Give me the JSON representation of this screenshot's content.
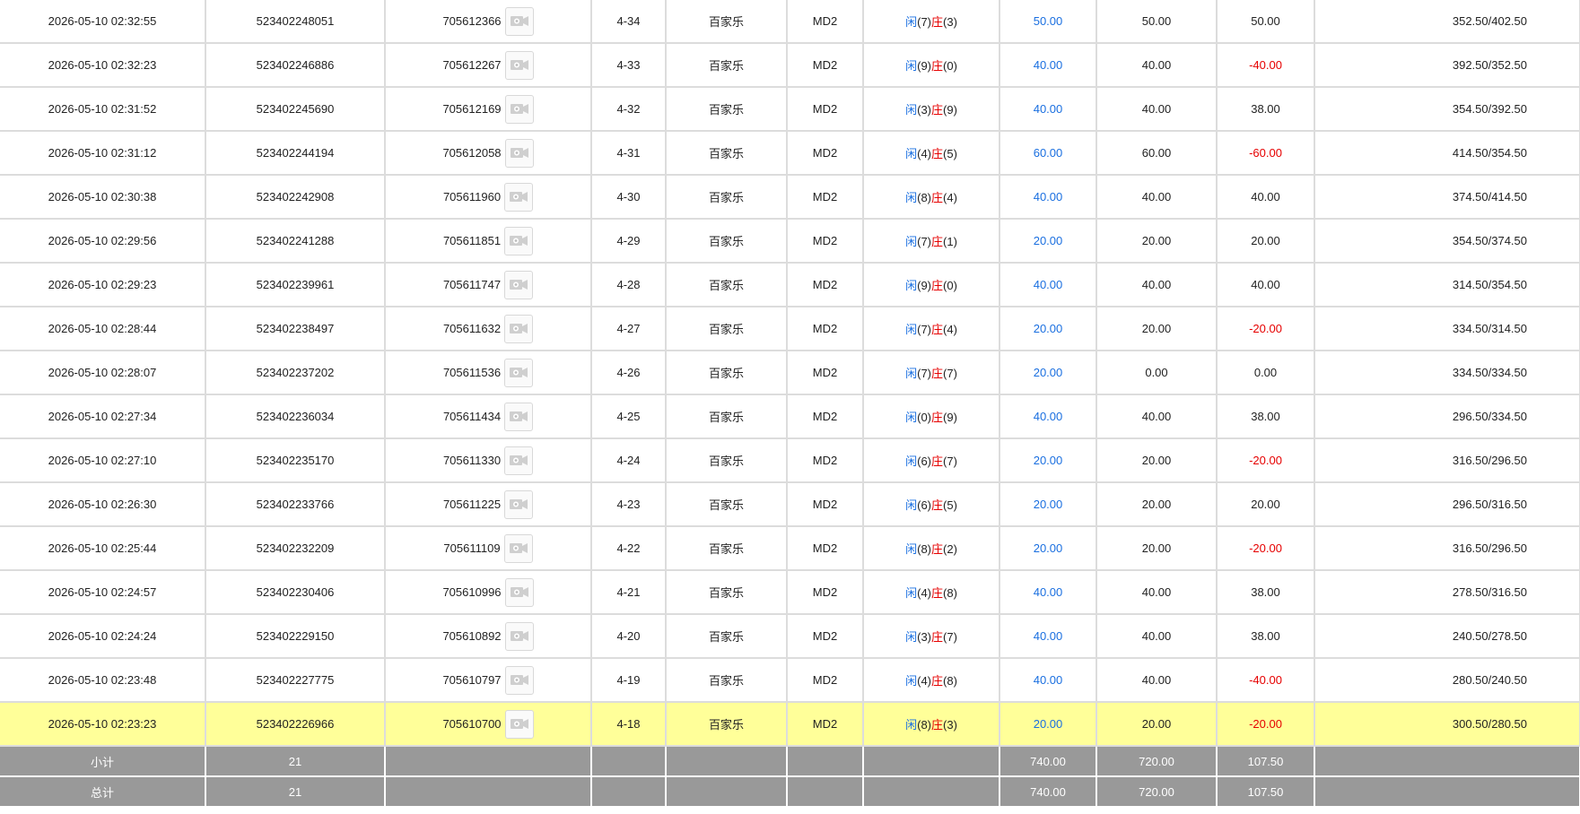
{
  "rows": [
    {
      "time": "2026-05-10 02:32:55",
      "bet_id": "523402248051",
      "game_id": "705612366",
      "shoe": "4-34",
      "game": "百家乐",
      "table": "MD2",
      "idle_label": "闲",
      "idle": "(7)",
      "banker_label": "庄",
      "banker": "(3)",
      "bet": "50.00",
      "valid": "50.00",
      "winloss": "50.00",
      "winloss_neg": false,
      "balance": "352.50/402.50"
    },
    {
      "time": "2026-05-10 02:32:23",
      "bet_id": "523402246886",
      "game_id": "705612267",
      "shoe": "4-33",
      "game": "百家乐",
      "table": "MD2",
      "idle_label": "闲",
      "idle": "(9)",
      "banker_label": "庄",
      "banker": "(0)",
      "bet": "40.00",
      "valid": "40.00",
      "winloss": "-40.00",
      "winloss_neg": true,
      "balance": "392.50/352.50"
    },
    {
      "time": "2026-05-10 02:31:52",
      "bet_id": "523402245690",
      "game_id": "705612169",
      "shoe": "4-32",
      "game": "百家乐",
      "table": "MD2",
      "idle_label": "闲",
      "idle": "(3)",
      "banker_label": "庄",
      "banker": "(9)",
      "bet": "40.00",
      "valid": "40.00",
      "winloss": "38.00",
      "winloss_neg": false,
      "balance": "354.50/392.50"
    },
    {
      "time": "2026-05-10 02:31:12",
      "bet_id": "523402244194",
      "game_id": "705612058",
      "shoe": "4-31",
      "game": "百家乐",
      "table": "MD2",
      "idle_label": "闲",
      "idle": "(4)",
      "banker_label": "庄",
      "banker": "(5)",
      "bet": "60.00",
      "valid": "60.00",
      "winloss": "-60.00",
      "winloss_neg": true,
      "balance": "414.50/354.50"
    },
    {
      "time": "2026-05-10 02:30:38",
      "bet_id": "523402242908",
      "game_id": "705611960",
      "shoe": "4-30",
      "game": "百家乐",
      "table": "MD2",
      "idle_label": "闲",
      "idle": "(8)",
      "banker_label": "庄",
      "banker": "(4)",
      "bet": "40.00",
      "valid": "40.00",
      "winloss": "40.00",
      "winloss_neg": false,
      "balance": "374.50/414.50"
    },
    {
      "time": "2026-05-10 02:29:56",
      "bet_id": "523402241288",
      "game_id": "705611851",
      "shoe": "4-29",
      "game": "百家乐",
      "table": "MD2",
      "idle_label": "闲",
      "idle": "(7)",
      "banker_label": "庄",
      "banker": "(1)",
      "bet": "20.00",
      "valid": "20.00",
      "winloss": "20.00",
      "winloss_neg": false,
      "balance": "354.50/374.50"
    },
    {
      "time": "2026-05-10 02:29:23",
      "bet_id": "523402239961",
      "game_id": "705611747",
      "shoe": "4-28",
      "game": "百家乐",
      "table": "MD2",
      "idle_label": "闲",
      "idle": "(9)",
      "banker_label": "庄",
      "banker": "(0)",
      "bet": "40.00",
      "valid": "40.00",
      "winloss": "40.00",
      "winloss_neg": false,
      "balance": "314.50/354.50"
    },
    {
      "time": "2026-05-10 02:28:44",
      "bet_id": "523402238497",
      "game_id": "705611632",
      "shoe": "4-27",
      "game": "百家乐",
      "table": "MD2",
      "idle_label": "闲",
      "idle": "(7)",
      "banker_label": "庄",
      "banker": "(4)",
      "bet": "20.00",
      "valid": "20.00",
      "winloss": "-20.00",
      "winloss_neg": true,
      "balance": "334.50/314.50"
    },
    {
      "time": "2026-05-10 02:28:07",
      "bet_id": "523402237202",
      "game_id": "705611536",
      "shoe": "4-26",
      "game": "百家乐",
      "table": "MD2",
      "idle_label": "闲",
      "idle": "(7)",
      "banker_label": "庄",
      "banker": "(7)",
      "bet": "20.00",
      "valid": "0.00",
      "winloss": "0.00",
      "winloss_neg": false,
      "balance": "334.50/334.50"
    },
    {
      "time": "2026-05-10 02:27:34",
      "bet_id": "523402236034",
      "game_id": "705611434",
      "shoe": "4-25",
      "game": "百家乐",
      "table": "MD2",
      "idle_label": "闲",
      "idle": "(0)",
      "banker_label": "庄",
      "banker": "(9)",
      "bet": "40.00",
      "valid": "40.00",
      "winloss": "38.00",
      "winloss_neg": false,
      "balance": "296.50/334.50"
    },
    {
      "time": "2026-05-10 02:27:10",
      "bet_id": "523402235170",
      "game_id": "705611330",
      "shoe": "4-24",
      "game": "百家乐",
      "table": "MD2",
      "idle_label": "闲",
      "idle": "(6)",
      "banker_label": "庄",
      "banker": "(7)",
      "bet": "20.00",
      "valid": "20.00",
      "winloss": "-20.00",
      "winloss_neg": true,
      "balance": "316.50/296.50"
    },
    {
      "time": "2026-05-10 02:26:30",
      "bet_id": "523402233766",
      "game_id": "705611225",
      "shoe": "4-23",
      "game": "百家乐",
      "table": "MD2",
      "idle_label": "闲",
      "idle": "(6)",
      "banker_label": "庄",
      "banker": "(5)",
      "bet": "20.00",
      "valid": "20.00",
      "winloss": "20.00",
      "winloss_neg": false,
      "balance": "296.50/316.50"
    },
    {
      "time": "2026-05-10 02:25:44",
      "bet_id": "523402232209",
      "game_id": "705611109",
      "shoe": "4-22",
      "game": "百家乐",
      "table": "MD2",
      "idle_label": "闲",
      "idle": "(8)",
      "banker_label": "庄",
      "banker": "(2)",
      "bet": "20.00",
      "valid": "20.00",
      "winloss": "-20.00",
      "winloss_neg": true,
      "balance": "316.50/296.50"
    },
    {
      "time": "2026-05-10 02:24:57",
      "bet_id": "523402230406",
      "game_id": "705610996",
      "shoe": "4-21",
      "game": "百家乐",
      "table": "MD2",
      "idle_label": "闲",
      "idle": "(4)",
      "banker_label": "庄",
      "banker": "(8)",
      "bet": "40.00",
      "valid": "40.00",
      "winloss": "38.00",
      "winloss_neg": false,
      "balance": "278.50/316.50"
    },
    {
      "time": "2026-05-10 02:24:24",
      "bet_id": "523402229150",
      "game_id": "705610892",
      "shoe": "4-20",
      "game": "百家乐",
      "table": "MD2",
      "idle_label": "闲",
      "idle": "(3)",
      "banker_label": "庄",
      "banker": "(7)",
      "bet": "40.00",
      "valid": "40.00",
      "winloss": "38.00",
      "winloss_neg": false,
      "balance": "240.50/278.50"
    },
    {
      "time": "2026-05-10 02:23:48",
      "bet_id": "523402227775",
      "game_id": "705610797",
      "shoe": "4-19",
      "game": "百家乐",
      "table": "MD2",
      "idle_label": "闲",
      "idle": "(4)",
      "banker_label": "庄",
      "banker": "(8)",
      "bet": "40.00",
      "valid": "40.00",
      "winloss": "-40.00",
      "winloss_neg": true,
      "balance": "280.50/240.50"
    },
    {
      "time": "2026-05-10 02:23:23",
      "bet_id": "523402226966",
      "game_id": "705610700",
      "shoe": "4-18",
      "game": "百家乐",
      "table": "MD2",
      "idle_label": "闲",
      "idle": "(8)",
      "banker_label": "庄",
      "banker": "(3)",
      "bet": "20.00",
      "valid": "20.00",
      "winloss": "-20.00",
      "winloss_neg": true,
      "balance": "300.50/280.50",
      "highlight": true
    }
  ],
  "subtotal": {
    "label": "小计",
    "count": "21",
    "bet": "740.00",
    "valid": "720.00",
    "winloss": "107.50"
  },
  "total": {
    "label": "总计",
    "count": "21",
    "bet": "740.00",
    "valid": "720.00",
    "winloss": "107.50"
  },
  "icons": {
    "replay": "video-replay-icon"
  },
  "colors": {
    "blue": "#1a6fe0",
    "red": "#e60000",
    "highlight": "#ffff99",
    "summary_bg": "#999999"
  }
}
